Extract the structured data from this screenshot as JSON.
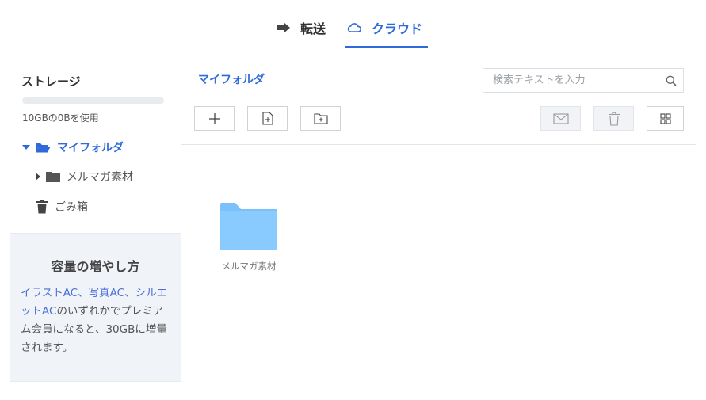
{
  "tabs": {
    "transfer": {
      "label": "転送",
      "icon": "arrow-right-icon"
    },
    "cloud": {
      "label": "クラウド",
      "icon": "cloud-icon",
      "active": true
    }
  },
  "sidebar": {
    "storage_title": "ストレージ",
    "storage_usage_fraction": 0.0,
    "storage_usage_text": "10GBの0Bを使用",
    "tree": {
      "root": {
        "label": "マイフォルダ",
        "icon": "folder-open-icon",
        "expanded": true
      },
      "children": [
        {
          "label": "メルマガ素材",
          "icon": "folder-icon",
          "expanded": false
        }
      ],
      "trash": {
        "label": "ごみ箱",
        "icon": "trash-icon"
      }
    },
    "promo": {
      "title": "容量の増やし方",
      "link_text": "イラストAC、写真AC、シルエットAC",
      "body_text": "のいずれかでプレミアム会員になると、30GBに増量されます。"
    }
  },
  "main": {
    "folder_title": "マイフォルダ",
    "search": {
      "placeholder": "検索テキストを入力",
      "value": ""
    },
    "toolbar": {
      "left": [
        {
          "name": "new-button",
          "icon": "plus-icon"
        },
        {
          "name": "upload-file-button",
          "icon": "file-add-icon"
        },
        {
          "name": "new-folder-button",
          "icon": "folder-add-icon"
        }
      ],
      "right": [
        {
          "name": "mail-button",
          "icon": "mail-icon",
          "disabled": true
        },
        {
          "name": "delete-button",
          "icon": "trash-icon",
          "disabled": true
        },
        {
          "name": "grid-view-button",
          "icon": "grid-icon",
          "disabled": false
        }
      ]
    },
    "items": [
      {
        "label": "メルマガ素材",
        "type": "folder",
        "icon": "folder-icon"
      }
    ]
  },
  "colors": {
    "accent": "#2f6ad9",
    "folder": "#8acbff",
    "promo_bg": "#f0f3f8"
  }
}
